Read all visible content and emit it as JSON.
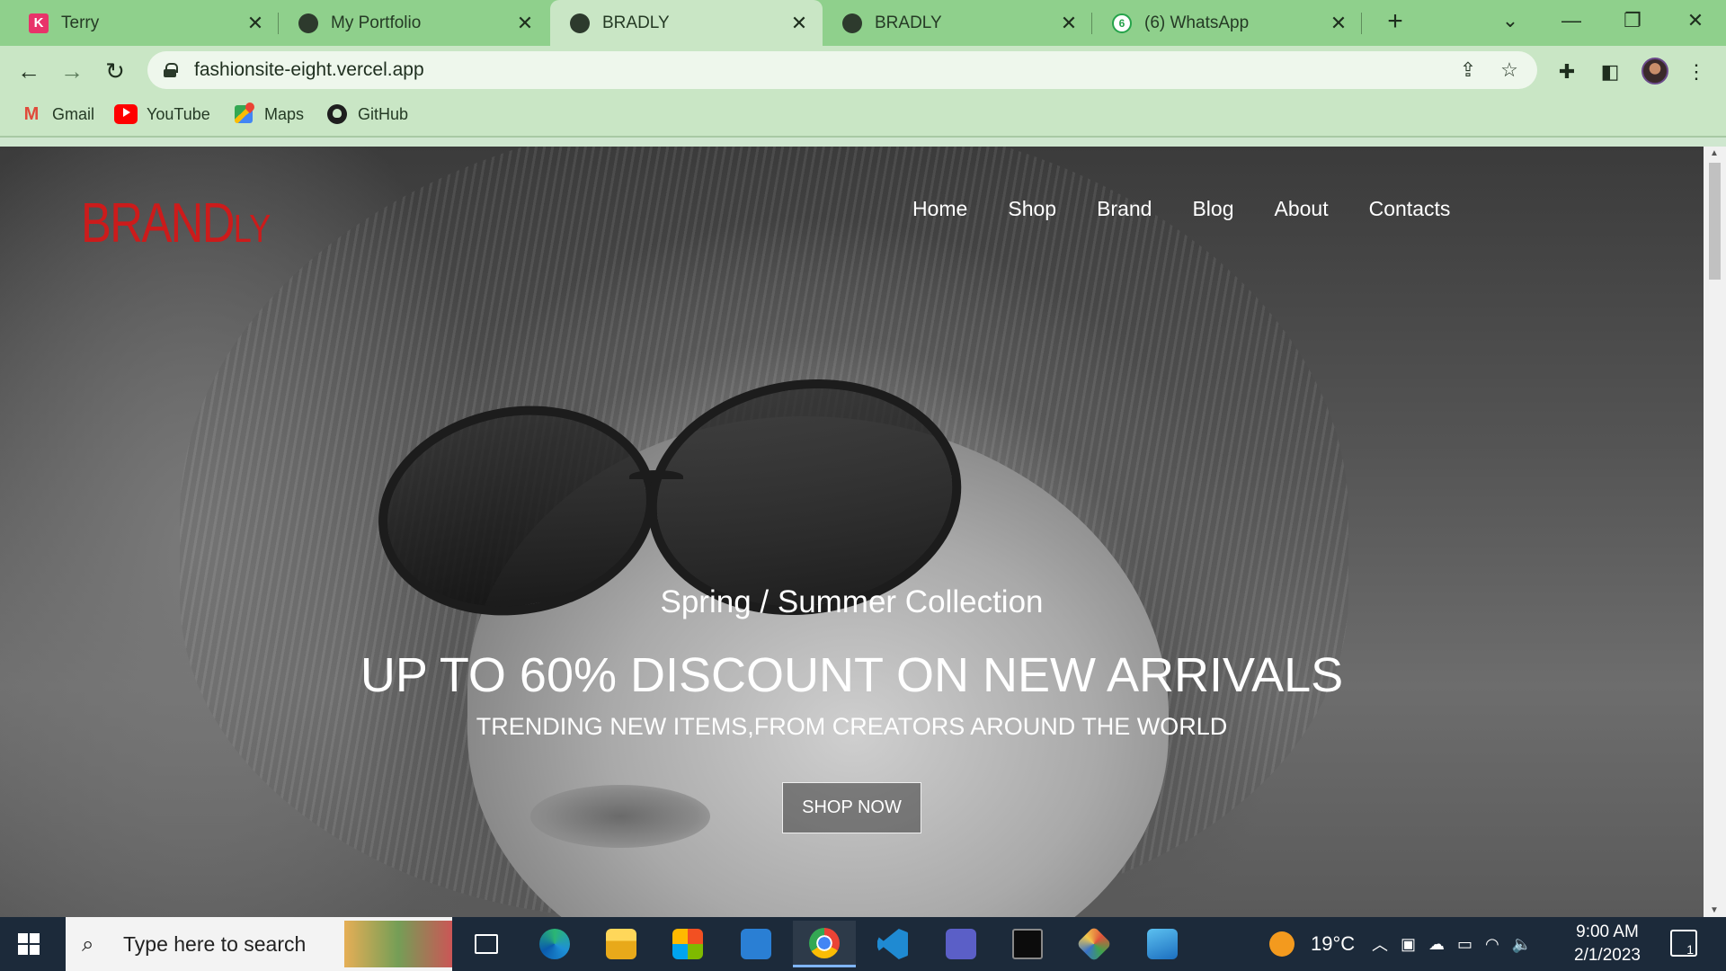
{
  "browser": {
    "tabs": [
      {
        "title": "Terry",
        "favicon": "k-icon",
        "active": false
      },
      {
        "title": "My Portfolio",
        "favicon": "globe-icon",
        "active": false
      },
      {
        "title": "BRADLY",
        "favicon": "globe-icon",
        "active": true
      },
      {
        "title": "BRADLY",
        "favicon": "globe-icon",
        "active": false
      },
      {
        "title": "(6) WhatsApp",
        "favicon": "whatsapp-icon",
        "active": false
      }
    ],
    "new_tab_icon": "plus-icon",
    "url": "fashionsite-eight.vercel.app",
    "bookmarks": [
      {
        "label": "Gmail",
        "icon": "gmail-icon"
      },
      {
        "label": "YouTube",
        "icon": "youtube-icon"
      },
      {
        "label": "Maps",
        "icon": "maps-icon"
      },
      {
        "label": "GitHub",
        "icon": "github-icon"
      }
    ],
    "theme_color": "#8fd08c"
  },
  "site": {
    "logo": {
      "main": "BRAND",
      "suffix": "LY",
      "color": "#cc1b1b"
    },
    "nav": [
      "Home",
      "Shop",
      "Brand",
      "Blog",
      "About",
      "Contacts"
    ],
    "hero": {
      "subtitle": "Spring / Summer Collection",
      "title": "UP TO 60% DISCOUNT ON NEW ARRIVALS",
      "tagline": "TRENDING NEW ITEMS,FROM CREATORS AROUND THE WORLD",
      "cta": "SHOP NOW"
    }
  },
  "taskbar": {
    "search_placeholder": "Type here to search",
    "apps": [
      "task-view-icon",
      "edge-icon",
      "file-explorer-icon",
      "store-icon",
      "mail-icon",
      "chrome-icon",
      "vscode-icon",
      "teams-icon",
      "terminal-icon",
      "git-icon",
      "photos-icon"
    ],
    "active_app": "chrome-icon",
    "weather": "19°C",
    "time": "9:00 AM",
    "date": "2/1/2023",
    "notifications": "1"
  }
}
